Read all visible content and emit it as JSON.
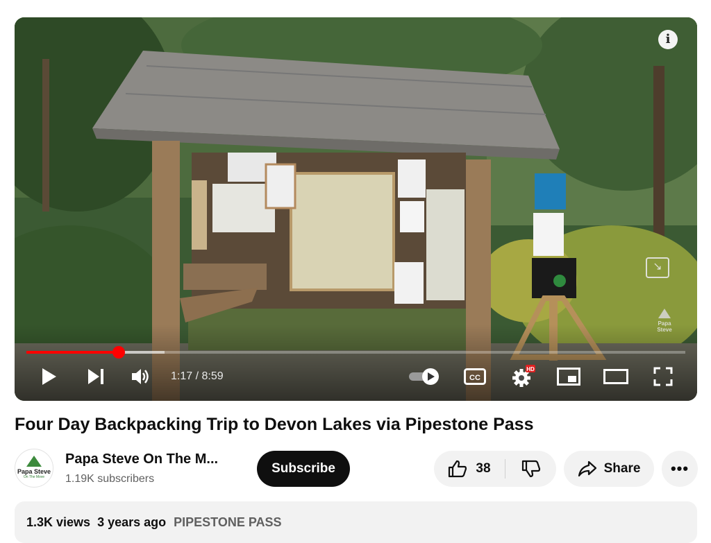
{
  "video": {
    "progress_fraction": 0.14,
    "buffered_fraction": 0.21,
    "current_time": "1:17",
    "duration": "8:59",
    "time_separator": " / ",
    "hd_badge": "HD",
    "watermark_line1": "Papa",
    "watermark_line2": "Steve"
  },
  "title": "Four Day Backpacking Trip to Devon Lakes via Pipestone Pass",
  "channel": {
    "name": "Papa Steve On The M...",
    "subscribers": "1.19K subscribers",
    "avatar_line1": "Papa Steve",
    "avatar_line2": "On The Move",
    "subscribe_label": "Subscribe"
  },
  "actions": {
    "like_count": "38",
    "share_label": "Share",
    "more_label": "•••"
  },
  "description": {
    "views": "1.3K views",
    "age": "3 years ago",
    "hashtag": "PIPESTONE PASS"
  },
  "colors": {
    "accent": "#ff0000",
    "subscribe_bg": "#0f0f0f",
    "chip_bg": "#f2f2f2"
  }
}
